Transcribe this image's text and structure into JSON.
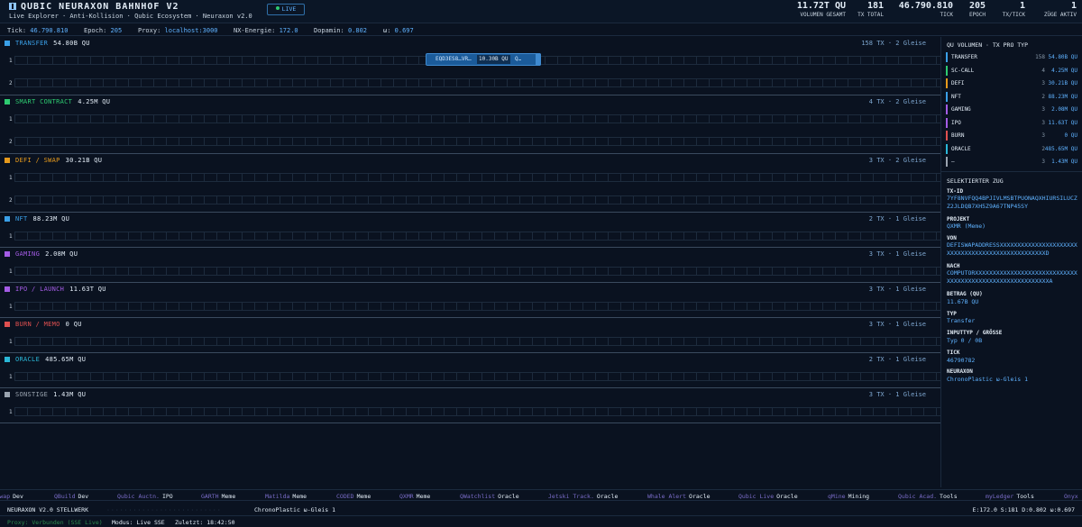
{
  "header": {
    "title": "QUBIC NEURAXON BAHNHOF V2",
    "subtitle": "Live Explorer · Anti-Kollision · Qubic Ecosystem · Neuraxon v2.0",
    "live_label": "LIVE",
    "stats": [
      {
        "value": "11.72T QU",
        "label": "VOLUMEN GESAMT"
      },
      {
        "value": "181",
        "label": "TX TOTAL"
      },
      {
        "value": "46.790.810",
        "label": "TICK"
      },
      {
        "value": "205",
        "label": "EPOCH"
      },
      {
        "value": "1",
        "label": "TX/TICK"
      },
      {
        "value": "1",
        "label": "ZÜGE AKTIV"
      }
    ]
  },
  "statusbar": {
    "tick_label": "Tick:",
    "tick": "46.790.810",
    "epoch_label": "Epoch:",
    "epoch": "205",
    "proxy_label": "Proxy:",
    "proxy": "localhost:3000",
    "nx_label": "NX-Energie:",
    "nx": "172.0",
    "dopamin_label": "Dopamin:",
    "dopamin": "0.802",
    "omega_label": "ω:",
    "omega": "0.697"
  },
  "colors": {
    "transfer": "#3aa0e8",
    "smart_contract": "#2ecc71",
    "defi": "#e69a1c",
    "nft": "#3aa0e8",
    "gaming": "#a45ce6",
    "ipo": "#a45ce6",
    "burn": "#e05050",
    "oracle": "#2ab8d8",
    "other": "#9aa4b0"
  },
  "lanes": [
    {
      "name": "TRANSFER",
      "volume": "54.80B QU",
      "info": "158 TX · 2 Gleise",
      "tracks": [
        "1",
        "2"
      ],
      "color": "#3aa0e8"
    },
    {
      "name": "SMART CONTRACT",
      "volume": "4.25M QU",
      "info": "4 TX · 2 Gleise",
      "tracks": [
        "1",
        "2"
      ],
      "color": "#2ecc71"
    },
    {
      "name": "DEFI / SWAP",
      "volume": "30.21B QU",
      "info": "3 TX · 2 Gleise",
      "tracks": [
        "1",
        "2"
      ],
      "color": "#e69a1c"
    },
    {
      "name": "NFT",
      "volume": "88.23M QU",
      "info": "2 TX · 1 Gleise",
      "tracks": [
        "1"
      ],
      "color": "#3aa0e8"
    },
    {
      "name": "GAMING",
      "volume": "2.08M QU",
      "info": "3 TX · 1 Gleise",
      "tracks": [
        "1"
      ],
      "color": "#a45ce6"
    },
    {
      "name": "IPO / LAUNCH",
      "volume": "11.63T QU",
      "info": "3 TX · 1 Gleise",
      "tracks": [
        "1"
      ],
      "color": "#a45ce6"
    },
    {
      "name": "BURN / MEMO",
      "volume": "0 QU",
      "info": "3 TX · 1 Gleise",
      "tracks": [
        "1"
      ],
      "color": "#e05050"
    },
    {
      "name": "ORACLE",
      "volume": "485.65M QU",
      "info": "2 TX · 1 Gleise",
      "tracks": [
        "1"
      ],
      "color": "#2ab8d8"
    },
    {
      "name": "SONSTIGE",
      "volume": "1.43M QU",
      "info": "3 TX · 1 Gleise",
      "tracks": [
        "1"
      ],
      "color": "#9aa4b0"
    }
  ],
  "train": {
    "id": "EQD3ES8…VR…",
    "amount": "10.30B QU",
    "tail": "Q…"
  },
  "volume_panel": {
    "title": "QU VOLUMEN · TX PRO TYP",
    "rows": [
      {
        "name": "TRANSFER",
        "count": "158",
        "qu": "54.80B QU",
        "color": "#3aa0e8"
      },
      {
        "name": "SC-CALL",
        "count": "4",
        "qu": "4.25M QU",
        "color": "#2ecc71"
      },
      {
        "name": "DEFI",
        "count": "3",
        "qu": "30.21B QU",
        "color": "#e69a1c"
      },
      {
        "name": "NFT",
        "count": "2",
        "qu": "88.23M QU",
        "color": "#3aa0e8"
      },
      {
        "name": "GAMING",
        "count": "3",
        "qu": "2.08M QU",
        "color": "#a45ce6"
      },
      {
        "name": "IPO",
        "count": "3",
        "qu": "11.63T QU",
        "color": "#a45ce6"
      },
      {
        "name": "BURN",
        "count": "3",
        "qu": "0 QU",
        "color": "#e05050"
      },
      {
        "name": "ORACLE",
        "count": "2",
        "qu": "485.65M QU",
        "color": "#2ab8d8"
      },
      {
        "name": "—",
        "count": "3",
        "qu": "1.43M QU",
        "color": "#9aa4b0"
      }
    ]
  },
  "selected": {
    "title": "SELEKTIERTER ZUG",
    "txid_label": "TX-ID",
    "txid": "7YF8NVFQQ4BPJIVLMSBTPUONAQXHIURSILUCZZ2JLDQB7XH5Z9A67TNP45SY",
    "project_label": "PROJEKT",
    "project": "QXMR (Meme)",
    "from_label": "VON",
    "from": "DEFISWAPADDRESSXXXXXXXXXXXXXXXXXXXXXXXXXXXXXXXXXXXXXXXXXXXXXXXXXXD",
    "to_label": "NACH",
    "to": "COMPUTORXXXXXXXXXXXXXXXXXXXXXXXXXXXXXXXXXXXXXXXXXXXXXXXXXXXXXXXXXXA",
    "amount_label": "BETRAG (QU)",
    "amount": "11.67B QU",
    "type_label": "TYP",
    "type": "Transfer",
    "inputtyp_label": "INPUTTYP / GRÖSSE",
    "inputtyp": "Typ 0 / 0B",
    "tick_label": "TICK",
    "tick": "46790782",
    "neuraxon_label": "NEURAXON",
    "neuraxon": "ChronoPlastic ω-Gleis 1"
  },
  "ticker": [
    {
      "name": "Qubic Swap",
      "type": "Dev"
    },
    {
      "name": "QBuild",
      "type": "Dev"
    },
    {
      "name": "Qubic Auctn.",
      "type": "IPO"
    },
    {
      "name": "GARTH",
      "type": "Meme"
    },
    {
      "name": "Matilda",
      "type": "Meme"
    },
    {
      "name": "CODED",
      "type": "Meme"
    },
    {
      "name": "QXMR",
      "type": "Meme"
    },
    {
      "name": "QWatchlist",
      "type": "Oracle"
    },
    {
      "name": "Jetski Track.",
      "type": "Oracle"
    },
    {
      "name": "Whale Alert",
      "type": "Oracle"
    },
    {
      "name": "Qubic Live",
      "type": "Oracle"
    },
    {
      "name": "qMine",
      "type": "Mining"
    },
    {
      "name": "Qubic Acad.",
      "type": "Tools"
    },
    {
      "name": "myLedger",
      "type": "Tools"
    },
    {
      "name": "Onyx",
      "type": ""
    }
  ],
  "footer": {
    "brand": "NEURAXON V2.0 STELLWERK",
    "track": "ChronoPlastic ω-Gleis 1",
    "right": "E:172.0  S:181  D:0.802  ω:0.697",
    "proxy": "Proxy: Verbunden (SSE Live)",
    "mode": "Modus: Live SSE",
    "last": "Zuletzt: 18:42:50"
  }
}
